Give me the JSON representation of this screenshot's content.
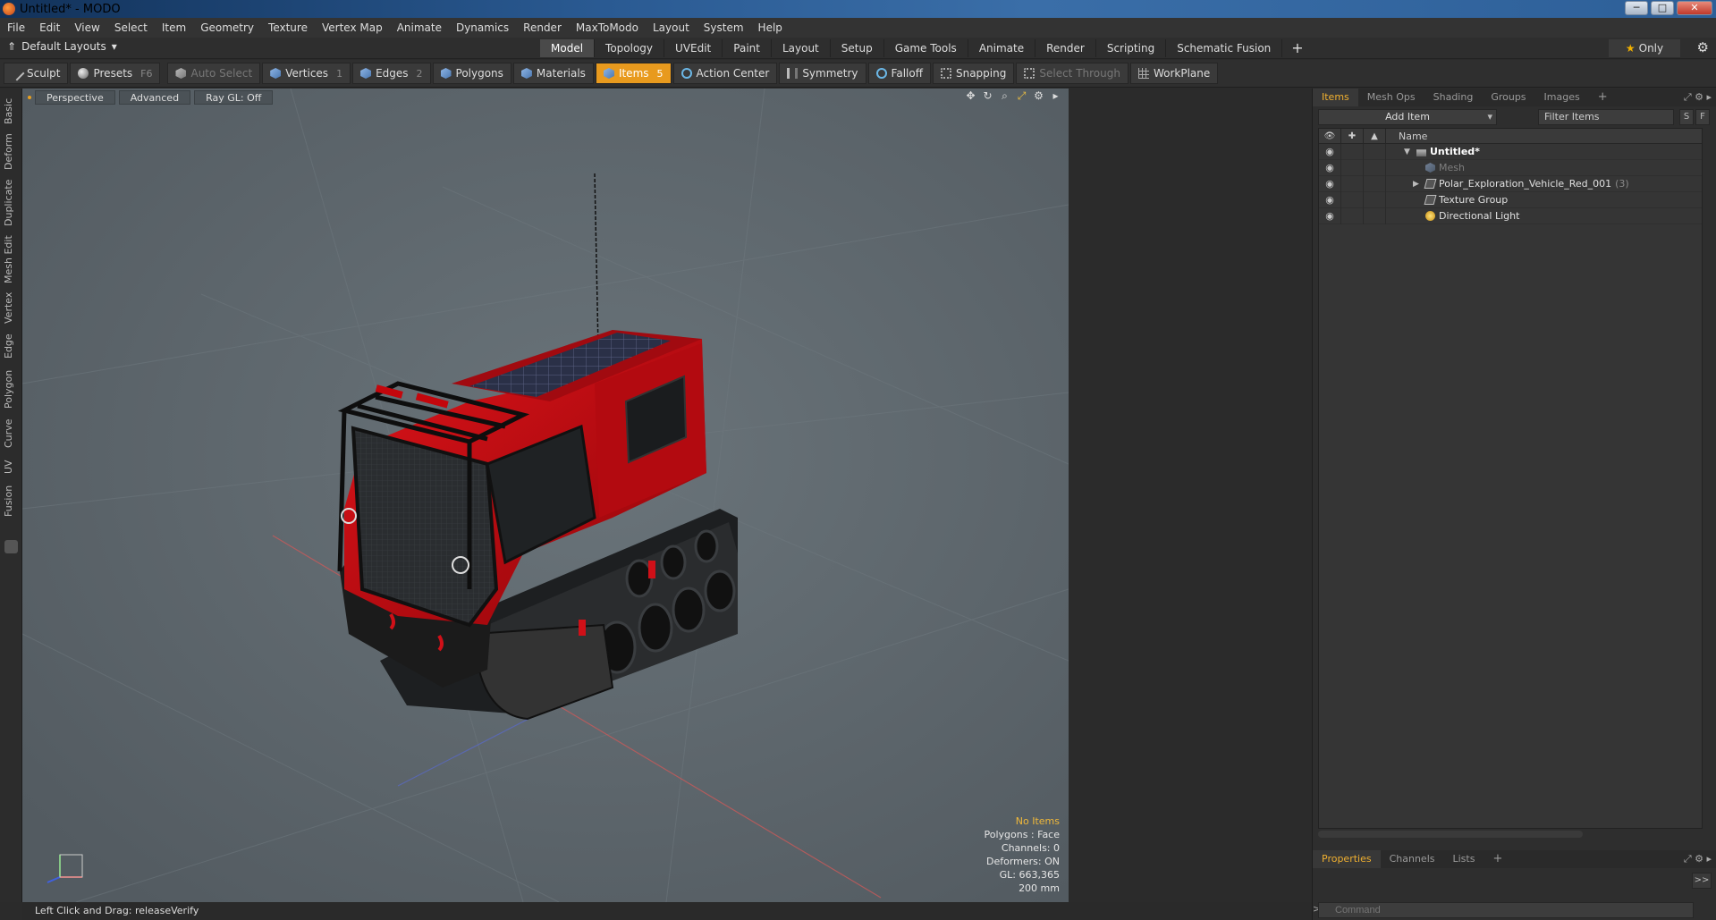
{
  "window": {
    "title": "Untitled* - MODO",
    "min": "─",
    "max": "□",
    "close": "✕"
  },
  "menu": [
    "File",
    "Edit",
    "View",
    "Select",
    "Item",
    "Geometry",
    "Texture",
    "Vertex Map",
    "Animate",
    "Dynamics",
    "Render",
    "MaxToModo",
    "Layout",
    "System",
    "Help"
  ],
  "layoutbar": {
    "layout": "Default Layouts",
    "tabs": [
      "Model",
      "Topology",
      "UVEdit",
      "Paint",
      "Layout",
      "Setup",
      "Game Tools",
      "Animate",
      "Render",
      "Scripting",
      "Schematic Fusion"
    ],
    "active_tab": "Model",
    "plus": "+",
    "only": "Only"
  },
  "toolbar": {
    "sculpt": "Sculpt",
    "presets": "Presets",
    "presets_key": "F6",
    "auto_select": "Auto Select",
    "vertices": "Vertices",
    "vertices_key": "1",
    "edges": "Edges",
    "edges_key": "2",
    "polygons": "Polygons",
    "materials": "Materials",
    "items": "Items",
    "items_key": "5",
    "action_center": "Action Center",
    "symmetry": "Symmetry",
    "falloff": "Falloff",
    "snapping": "Snapping",
    "select_through": "Select Through",
    "workplane": "WorkPlane"
  },
  "lefttabs": [
    "Basic",
    "Deform",
    "Duplicate",
    "Mesh Edit",
    "Vertex",
    "Edge",
    "Polygon",
    "Curve",
    "UV",
    "Fusion"
  ],
  "viewport": {
    "view": "Perspective",
    "mode": "Advanced",
    "raygl": "Ray GL: Off",
    "info": {
      "no_items": "No Items",
      "polygons": "Polygons : Face",
      "channels": "Channels: 0",
      "deformers": "Deformers: ON",
      "gl": "GL: 663,365",
      "scale": "200 mm"
    }
  },
  "items_panel": {
    "tabs": [
      "Items",
      "Mesh Ops",
      "Shading",
      "Groups",
      "Images"
    ],
    "active_tab": "Items",
    "add_item": "Add Item",
    "filter": "Filter Items",
    "s": "S",
    "f": "F",
    "name_header": "Name",
    "tree": [
      {
        "label": "Untitled*",
        "count": ""
      },
      {
        "label": "Mesh",
        "count": ""
      },
      {
        "label": "Polar_Exploration_Vehicle_Red_001",
        "count": "(3)"
      },
      {
        "label": "Texture Group",
        "count": ""
      },
      {
        "label": "Directional Light",
        "count": ""
      }
    ]
  },
  "props_panel": {
    "tabs": [
      "Properties",
      "Channels",
      "Lists"
    ],
    "active_tab": "Properties",
    "expand": ">>",
    "command_placeholder": "Command"
  },
  "statusbar": {
    "text": "Left Click and Drag:  releaseVerify"
  },
  "colors": {
    "accent": "#e89a1e",
    "vehicle_red": "#c4060c",
    "viewport_bg": "#5e676d"
  }
}
